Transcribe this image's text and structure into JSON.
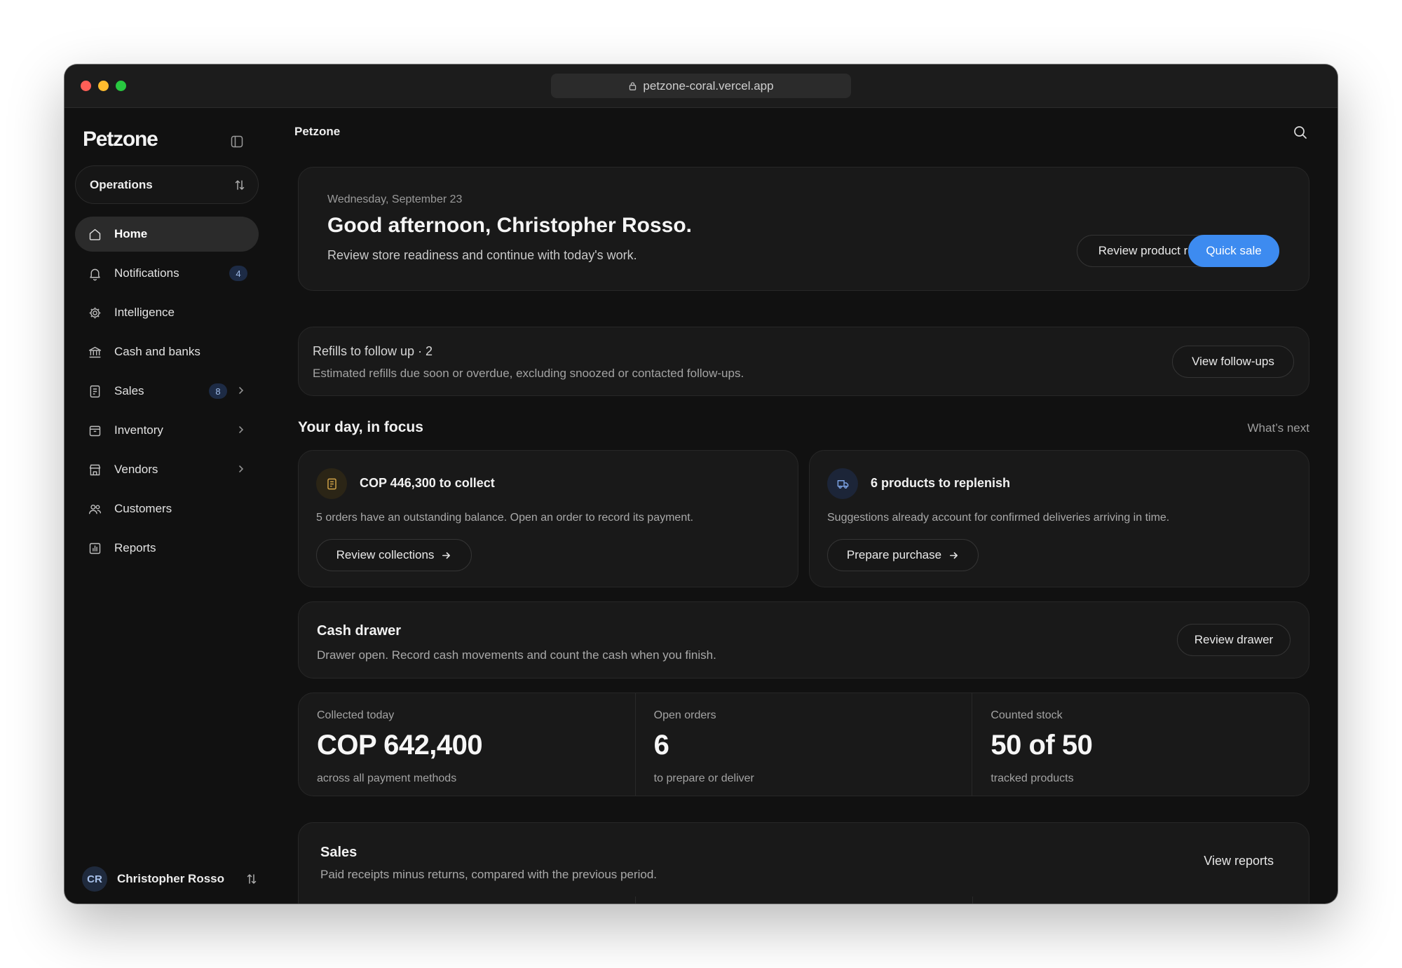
{
  "browser": {
    "url": "petzone-coral.vercel.app"
  },
  "sidebar": {
    "logo": "Petzone",
    "workspace": "Operations",
    "items": [
      {
        "label": "Home",
        "icon": "home-icon"
      },
      {
        "label": "Notifications",
        "icon": "bell-icon",
        "badge": "4"
      },
      {
        "label": "Intelligence",
        "icon": "gear-icon"
      },
      {
        "label": "Cash and banks",
        "icon": "bank-icon"
      },
      {
        "label": "Sales",
        "icon": "receipt-icon",
        "badge": "8"
      },
      {
        "label": "Inventory",
        "icon": "box-icon"
      },
      {
        "label": "Vendors",
        "icon": "store-icon"
      },
      {
        "label": "Customers",
        "icon": "users-icon"
      },
      {
        "label": "Reports",
        "icon": "chart-icon"
      }
    ],
    "user": {
      "initials": "CR",
      "name": "Christopher Rosso"
    }
  },
  "header": {
    "title": "Petzone"
  },
  "hero": {
    "date": "Wednesday, September 23",
    "greeting": "Good afternoon, Christopher Rosso.",
    "subtitle": "Review store readiness and continue with today's work.",
    "secondary_button": "Review product records",
    "primary_button": "Quick sale"
  },
  "refills": {
    "title": "Refills to follow up · 2",
    "description": "Estimated refills due soon or overdue, excluding snoozed or contacted follow-ups.",
    "button": "View follow-ups"
  },
  "focus": {
    "title": "Your day, in focus",
    "link": "What’s next",
    "cards": [
      {
        "title": "COP 446,300 to collect",
        "description": "5 orders have an outstanding balance. Open an order to record its payment.",
        "button": "Review collections"
      },
      {
        "title": "6 products to replenish",
        "description": "Suggestions already account for confirmed deliveries arriving in time.",
        "button": "Prepare purchase"
      }
    ]
  },
  "drawer": {
    "title": "Cash drawer",
    "description": "Drawer open. Record cash movements and count the cash when you finish.",
    "button": "Review drawer"
  },
  "stats": [
    {
      "label": "Collected today",
      "value": "COP 642,400",
      "hint": "across all payment methods"
    },
    {
      "label": "Open orders",
      "value": "6",
      "hint": "to prepare or deliver"
    },
    {
      "label": "Counted stock",
      "value": "50 of 50",
      "hint": "tracked products"
    }
  ],
  "sales": {
    "title": "Sales",
    "description": "Paid receipts minus returns, compared with the previous period.",
    "link": "View reports"
  },
  "colors": {
    "accent": "#3d8bf0",
    "background": "#111111",
    "card": "#191919"
  }
}
